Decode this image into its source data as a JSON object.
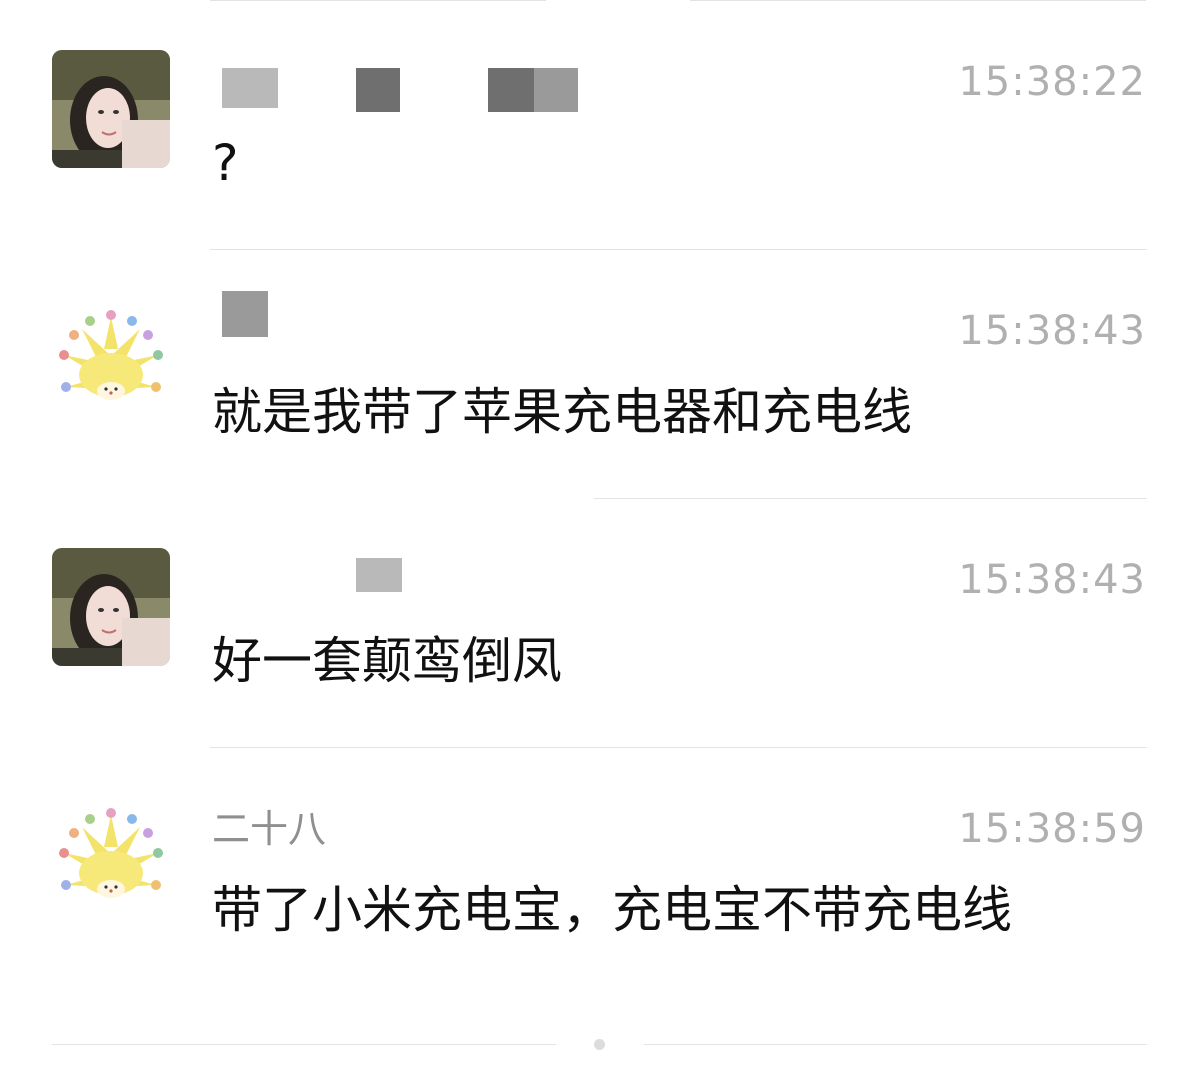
{
  "messages": [
    {
      "sender": "",
      "time": "15:38:22",
      "text": "?",
      "avatar": "girl-photo-avatar"
    },
    {
      "sender": "",
      "time": "15:38:43",
      "text": "就是我带了苹果充电器和充电线",
      "avatar": "hedgehog-avatar"
    },
    {
      "sender": "",
      "time": "15:38:43",
      "text": "好一套颠鸾倒凤",
      "avatar": "girl-photo-avatar"
    },
    {
      "sender": "二十八",
      "time": "15:38:59",
      "text": "带了小米充电宝，充电宝不带充电线",
      "avatar": "hedgehog-avatar"
    }
  ],
  "colors": {
    "time": "#b0b0b0",
    "sender": "#8f8f8f",
    "text": "#111111",
    "divider": "#e3e3e3"
  }
}
